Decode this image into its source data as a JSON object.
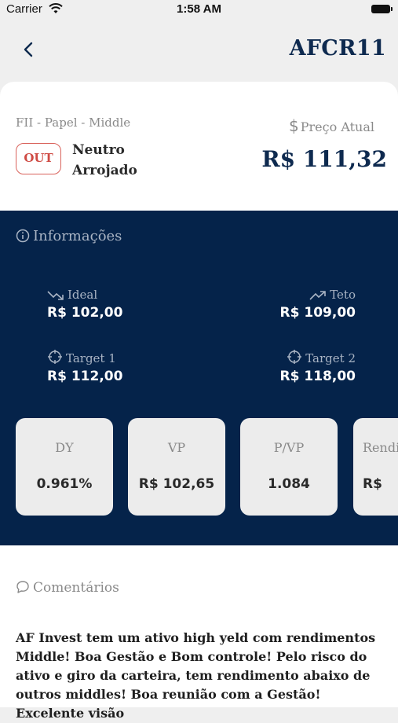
{
  "status_bar": {
    "carrier": "Carrier",
    "time": "1:58 AM"
  },
  "nav": {
    "title": "AFCR11"
  },
  "header": {
    "category": "FII - Papel - Middle",
    "badge": "OUT",
    "profile_line1": "Neutro",
    "profile_line2": "Arrojado",
    "price_label": "Preço Atual",
    "price_value": "R$ 111,32"
  },
  "info": {
    "title": "Informações",
    "ideal": {
      "label": "Ideal",
      "value": "R$ 102,00"
    },
    "teto": {
      "label": "Teto",
      "value": "R$ 109,00"
    },
    "target1": {
      "label": "Target 1",
      "value": "R$ 112,00"
    },
    "target2": {
      "label": "Target 2",
      "value": "R$ 118,00"
    },
    "stats": [
      {
        "label": "DY",
        "value": "0.961%"
      },
      {
        "label": "VP",
        "value": "R$ 102,65"
      },
      {
        "label": "P/VP",
        "value": "1.084"
      },
      {
        "label": "Rendi",
        "value": "R$"
      }
    ]
  },
  "comments": {
    "title": "Comentários",
    "text": "AF Invest tem um ativo high yeld com rendimentos Middle! Boa Gestão e Bom controle! Pelo risco do ativo e giro da carteira, tem rendimento abaixo de outros middles! Boa reunião com a Gestão! Excelente visão"
  },
  "colors": {
    "navy": "#05234a",
    "title_navy": "#0e2a4f",
    "out_red": "#cf4b44"
  },
  "icons": [
    "wifi-icon",
    "battery-icon",
    "back-chevron-icon",
    "dollar-icon",
    "info-icon",
    "trend-down-icon",
    "trend-up-icon",
    "target-icon",
    "comment-icon"
  ]
}
